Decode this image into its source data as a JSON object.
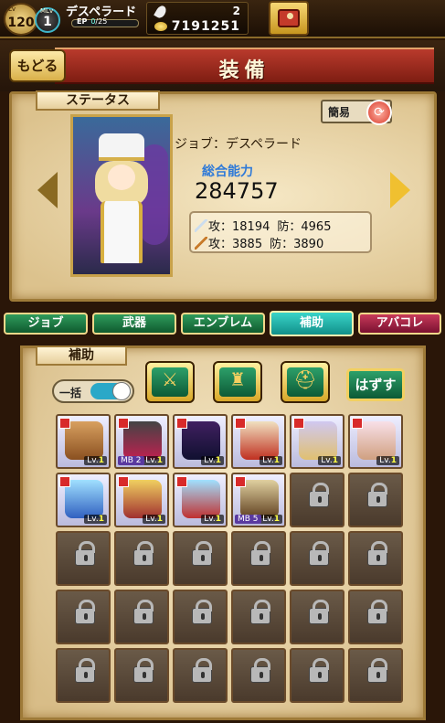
{
  "player": {
    "lv_label": "Lv",
    "level": "120",
    "ml_label": "MLv",
    "master_level": "1",
    "job": "デスペラード",
    "ep_label": "EP",
    "ep_current": "0",
    "ep_max": "/25",
    "ep_fraction": 0.0,
    "feathers": "2",
    "gold": "7191251"
  },
  "header": {
    "back_label": "もどる",
    "title": "装備"
  },
  "status": {
    "tab_label": "ステータス",
    "simple_label": "簡易",
    "job_line": "ジョブ：デスペラード",
    "power_label": "総合能力",
    "power_value": "284757",
    "phys_atk_label": "攻：",
    "phys_atk": "18194",
    "phys_def_label": "防：",
    "phys_def": "4965",
    "mag_atk_label": "攻：",
    "mag_atk": "3885",
    "mag_def_label": "防：",
    "mag_def": "3890"
  },
  "tabs": [
    {
      "label": "ジョブ"
    },
    {
      "label": "武器"
    },
    {
      "label": "エンブレム"
    },
    {
      "label": "補助"
    },
    {
      "label": "アバコレ"
    }
  ],
  "support": {
    "tab_label": "補助",
    "bulk_label": "一括",
    "unequip_label": "はずす"
  },
  "cards": [
    {
      "lv_label": "Lv.",
      "lv": "1",
      "mb": ""
    },
    {
      "lv_label": "Lv.",
      "lv": "1",
      "mb": "MB 2"
    },
    {
      "lv_label": "Lv.",
      "lv": "1",
      "mb": ""
    },
    {
      "lv_label": "Lv.",
      "lv": "1",
      "mb": ""
    },
    {
      "lv_label": "Lv.",
      "lv": "1",
      "mb": ""
    },
    {
      "lv_label": "Lv.",
      "lv": "1",
      "mb": ""
    },
    {
      "lv_label": "Lv.",
      "lv": "1",
      "mb": ""
    },
    {
      "lv_label": "Lv.",
      "lv": "1",
      "mb": ""
    },
    {
      "lv_label": "Lv.",
      "lv": "1",
      "mb": ""
    },
    {
      "lv_label": "Lv.",
      "lv": "1",
      "mb": "MB 5"
    }
  ],
  "colors": {
    "accent_green": "#0f5a2e",
    "active_tab": "#11908a",
    "banner_red": "#b93a2c",
    "power_blue": "#2f7ad8"
  }
}
